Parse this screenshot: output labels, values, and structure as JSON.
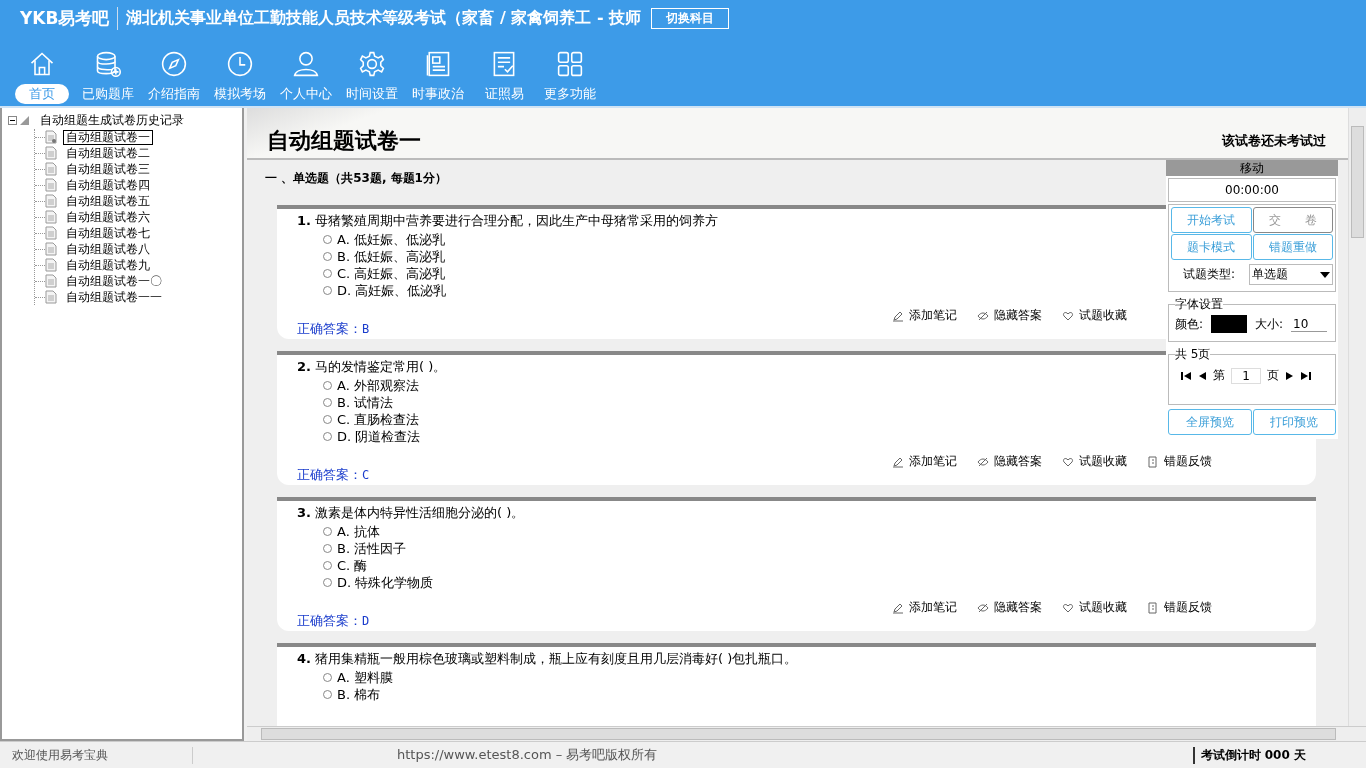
{
  "header": {
    "logo": "YKB易考吧",
    "title": "湖北机关事业单位工勤技能人员技术等级考试（家畜 / 家禽饲养工 - 技师",
    "switch_button": "切换科目"
  },
  "nav": [
    {
      "label": "首页",
      "kind": "home",
      "selected": true
    },
    {
      "label": "已购题库",
      "kind": "database",
      "selected": false
    },
    {
      "label": "介绍指南",
      "kind": "compass",
      "selected": false
    },
    {
      "label": "模拟考场",
      "kind": "clock",
      "selected": false
    },
    {
      "label": "个人中心",
      "kind": "person",
      "selected": false
    },
    {
      "label": "时间设置",
      "kind": "gear",
      "selected": false
    },
    {
      "label": "时事政治",
      "kind": "news",
      "selected": false
    },
    {
      "label": "证照易",
      "kind": "checklist",
      "selected": false
    },
    {
      "label": "更多功能",
      "kind": "grid",
      "selected": false
    }
  ],
  "tree": {
    "label": "自动组题生成试卷历史记录",
    "expanded": true,
    "children": [
      {
        "label": "自动组题试卷一",
        "selected": true
      },
      {
        "label": "自动组题试卷二",
        "selected": false
      },
      {
        "label": "自动组题试卷三",
        "selected": false
      },
      {
        "label": "自动组题试卷四",
        "selected": false
      },
      {
        "label": "自动组题试卷五",
        "selected": false
      },
      {
        "label": "自动组题试卷六",
        "selected": false
      },
      {
        "label": "自动组题试卷七",
        "selected": false
      },
      {
        "label": "自动组题试卷八",
        "selected": false
      },
      {
        "label": "自动组题试卷九",
        "selected": false
      },
      {
        "label": "自动组题试卷一〇",
        "selected": false
      },
      {
        "label": "自动组题试卷一一",
        "selected": false
      }
    ]
  },
  "paper": {
    "title": "自动组题试卷一",
    "status": "该试卷还未考试过",
    "section": "一 、单选题（共53题, 每题1分）"
  },
  "questions": [
    {
      "number": "1.",
      "text": "母猪繁殖周期中营养要进行合理分配，因此生产中母猪常采用的饲养方",
      "options": [
        {
          "label": "A. 低妊娠、低泌乳",
          "selected": false
        },
        {
          "label": "B. 低妊娠、高泌乳",
          "selected": false
        },
        {
          "label": "C. 高妊娠、高泌乳",
          "selected": false
        },
        {
          "label": "D. 高妊娠、低泌乳",
          "selected": false
        }
      ],
      "answer_label": "正确答案：",
      "answer": "B",
      "actions": [
        "添加笔记",
        "隐藏答案",
        "试题收藏"
      ]
    },
    {
      "number": "2.",
      "text": "马的发情鉴定常用( )。",
      "options": [
        {
          "label": "A. 外部观察法",
          "selected": false
        },
        {
          "label": "B. 试情法",
          "selected": false
        },
        {
          "label": "C. 直肠检查法",
          "selected": false
        },
        {
          "label": "D. 阴道检查法",
          "selected": false
        }
      ],
      "answer_label": "正确答案：",
      "answer": "C",
      "actions": [
        "添加笔记",
        "隐藏答案",
        "试题收藏",
        "错题反馈"
      ]
    },
    {
      "number": "3.",
      "text": "激素是体内特异性活细胞分泌的( )。",
      "options": [
        {
          "label": "A. 抗体",
          "selected": false
        },
        {
          "label": "B. 活性因子",
          "selected": false
        },
        {
          "label": "C. 酶",
          "selected": false
        },
        {
          "label": "D. 特殊化学物质",
          "selected": false
        }
      ],
      "answer_label": "正确答案：",
      "answer": "D",
      "actions": [
        "添加笔记",
        "隐藏答案",
        "试题收藏",
        "错题反馈"
      ]
    },
    {
      "number": "4.",
      "text": "猪用集精瓶一般用棕色玻璃或塑料制成，瓶上应有刻度且用几层消毒好( )包扎瓶口。",
      "options": [
        {
          "label": "A. 塑料膜",
          "selected": false
        },
        {
          "label": "B. 棉布",
          "selected": false
        }
      ]
    }
  ],
  "panel": {
    "move": "移动",
    "timer": "00:00:00",
    "buttons": [
      {
        "label": "开始考试",
        "disabled": false
      },
      {
        "label": "交　　卷",
        "disabled": true
      },
      {
        "label": "题卡模式",
        "disabled": false
      },
      {
        "label": "错题重做",
        "disabled": false
      }
    ],
    "type_label": "试题类型:",
    "type_value": "单选题",
    "font_legend": "字体设置",
    "color_label": "颜色:",
    "color": "#000000",
    "size_label": "大小:",
    "size_value": "10",
    "pages_legend": "共 5页",
    "page_prefix": "第",
    "page_value": "1",
    "page_suffix": "页",
    "bottom_buttons": [
      "全屏预览",
      "打印预览"
    ]
  },
  "status_bar": {
    "welcome": "欢迎使用易考宝典",
    "copyright": "https://www.etest8.com – 易考吧版权所有",
    "countdown": "考试倒计时 000 天"
  }
}
